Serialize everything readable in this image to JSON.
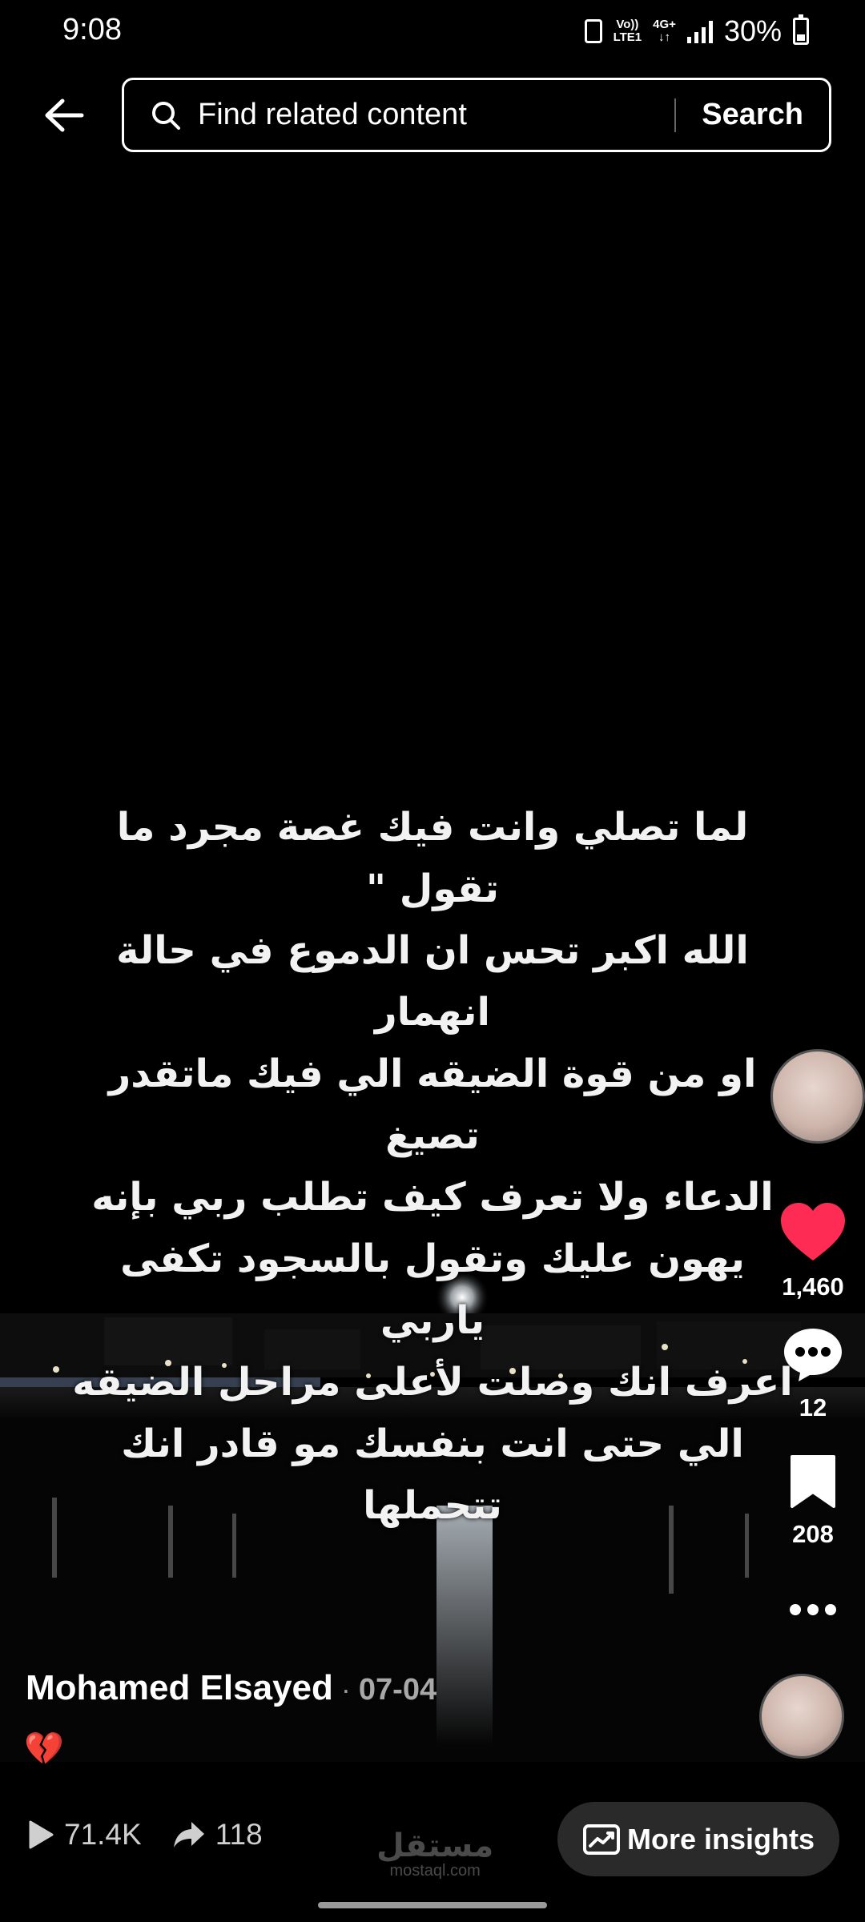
{
  "status_bar": {
    "time": "9:08",
    "network_top": "Vo))",
    "network_bottom": "LTE1",
    "data_top": "4G+",
    "data_bottom": "↓↑",
    "battery": "30%"
  },
  "search": {
    "placeholder": "Find related content",
    "button_label": "Search"
  },
  "video": {
    "caption_lines": [
      "لما تصلي وانت فيك غصة مجرد ما تقول \"",
      "الله اكبر تحس ان الدموع في حالة انهمار",
      "او من قوة الضيقه الي فيك ماتقدر تصيغ",
      "الدعاء ولا تعرف كيف تطلب ربي بإنه",
      "يهون عليك وتقول بالسجود تكفى ياربي",
      "اعرف انك وصلت لأعلى مراحل الضيقه",
      "الي حتى انت بنفسك مو قادر انك",
      "تتحملها"
    ]
  },
  "actions": {
    "likes": "1,460",
    "comments": "12",
    "saves": "208"
  },
  "post": {
    "author": "Mohamed Elsayed",
    "separator": "·",
    "date": "07-04",
    "description": "💔"
  },
  "stats": {
    "plays": "71.4K",
    "shares": "118"
  },
  "watermark": {
    "arabic": "مستقل",
    "latin": "mostaql.com"
  },
  "insights_button": "More insights",
  "colors": {
    "like": "#fe2c55",
    "background": "#000000",
    "button_bg": "#2a2a2a"
  }
}
